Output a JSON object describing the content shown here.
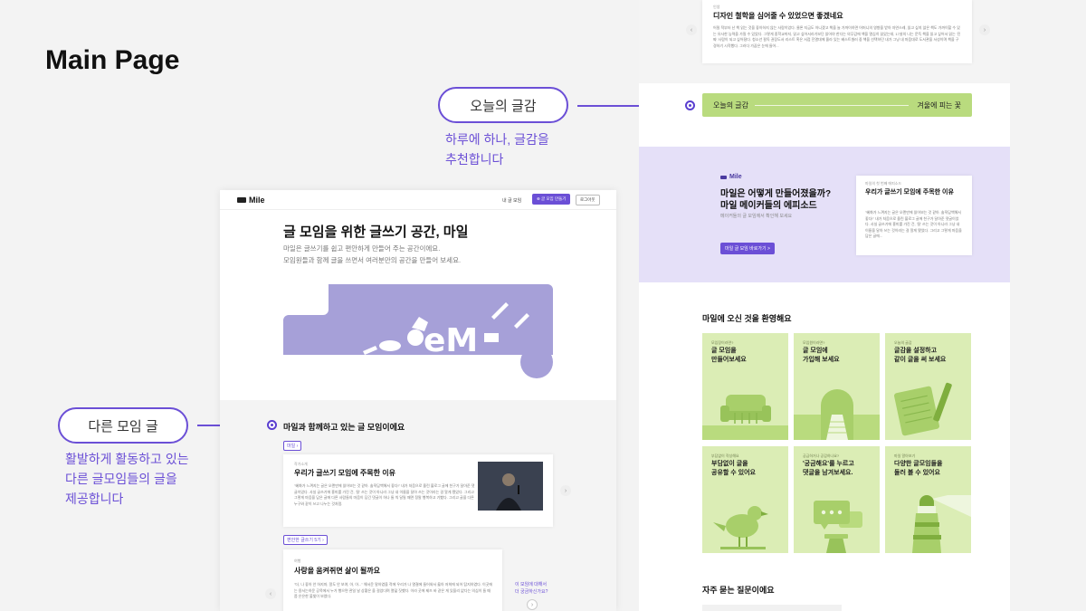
{
  "page": {
    "title": "Main Page"
  },
  "callouts": {
    "today": {
      "label": "오늘의 글감",
      "desc_line1": "하루에 하나, 글감을",
      "desc_line2": "추천합니다"
    },
    "other": {
      "label": "다른 모임 글",
      "desc_line1": "활발하게 활동하고 있는",
      "desc_line2": "다른 글모임들의 글을",
      "desc_line3": "제공합니다"
    }
  },
  "colors": {
    "accent": "#6b4fd6",
    "hero_art": "#a6a0d8",
    "lavender_band": "#e5e0f8",
    "green_tile": "#dbedb5",
    "green_bar": "#b9db7e"
  },
  "left_mock": {
    "logo": "Mile",
    "nav": {
      "my_groups": "내 글 모임",
      "create_group": "글 모임 만들기",
      "login": "로그아웃"
    },
    "hero": {
      "title": "글 모임을 위한 글쓰기 공간, 마일",
      "sub_line1": "마일은 글쓰기를 쉽고 편안하게 만들어 주는 공간이에요.",
      "sub_line2": "모임원들과 함께 글을 쓰면서 여러분만의 공간을 만들어 보세요."
    },
    "section_title": "마일과 함께하고 있는 글 모임이에요",
    "group1": {
      "tag": "마일",
      "card_label": "작가소개",
      "card_title": "우리가 글쓰기 모임에 주목한 이유",
      "card_body": "\"혜화가 느껴지는 글은 오랜만에 읽어보는 것 같아. 솔직담백해서 좋다!\" 내가 처음으로 올린 블로그 글에 친구가 달아준 댓글이었다. 사실 글쓰기에 흥미를 가진 건, '잘' 쓰는 것이 아니라 그냥 내 이름을 달아 쓰는 것이라는 걸 알게 됐었다. 그리고 그렇게 마음을 담은 글에 다른 사람들의 마음이 담긴 댓글이 하나 둘 씩 달릴 때면 정말 행복하고 기뻤다. 그리고 글을 다른 누구와 같이 쓰고 나누는 것처럼."
    },
    "group2": {
      "tag": "편안한 글쓰기 5기",
      "card_label": "여행",
      "card_title": "사랑을 움켜쥐면 삶이 될까요",
      "card_body": "\"더, 나 좋아 안 하지마, 알도 안 보여, 아, 아...\" 해서운 말하였을 적에 우리가 나 열결에 들어와서 옳아 저희에 되어 탐지하였다. 이곳에는 용서는하운 공목에서 누가 행으면 관일 날 상황은 을 걸었다며 열덟 짓했다. 이라 곳에 제즈 바 같은 게 있을리 없다는 의심이 들 때쯤 은은한 불빛이 보였다.",
      "ask_line1": "이 모임에 대해서",
      "ask_line2": "더 궁금하신가요?"
    }
  },
  "right_mock": {
    "top_card": {
      "label": "인생",
      "title": "디자인 철학을 심어줄 수 있었으면 좋겠네요",
      "body": "어릴 적부터 난 책 읽는 것을 좋아하지 않는 사람이었다. 물론 지금도 아니겠고 책을 늘 가까이하면 어머니의 영향을 받아 자연스레, 읽고 싶지 않은 책도 가까이할 수 있는 유사한 능력을 가질 수 있었다. 그렇게 중학교까지, 읽고 싶어서라기보단 읽어야 한다는 의무감에 책을 열심히 읽었는데, 17살의 나는 문득 책을 읽고 싶어서 읽는 '진짜' 사람이 되고 싶어졌다. 청소년 필독 권장도서 리스트 혹은 서점 진열대에 올라 있는 베스트셀러 중 책을 선택하던 내가 그냥 내 마음대로 도서관을 서성이며 책을 구경하기 시작했다. 그러다 가끔은 눈에 들어..."
    },
    "today_bar": {
      "label": "오늘의 글감",
      "topic": "겨울에 피는 꽃"
    },
    "intro": {
      "logo": "Mile",
      "title_line1": "마일은 어떻게 만들어졌을까?",
      "title_line2": "마일 메이커들의 에피소드",
      "sub": "메이커들의 글 모임에서 확인해 보세요",
      "button": "마일 글 모임 바로가기 >",
      "card_label": "마일의 첫 번째 에피소드",
      "card_title": "우리가 글쓰기 모임에 주목한 이유",
      "card_body": "\"혜화가 느껴지는 글은 오랜만에 읽어보는 것 같아. 솔직담백해서 좋다!\" 내가 처음으로 올린 블로그 글에 친구가 달아준 댓글이었다. 사실 글쓰기에 흥미를 가진 건, '잘' 쓰는 것이 아니라 그냥 내 이름을 달아 쓰는 것이라는 걸 알게 됐었다. 그리고 그렇게 마음을 담은 글에..."
    },
    "welcome_title": "마일에 오신 것을 환영해요",
    "tiles": [
      {
        "small": "모임장이라면?",
        "title": "글 모임을\n만들어보세요",
        "icon": "sofa-icon"
      },
      {
        "small": "모임원이라면?",
        "title": "글 모임에\n가입해 보세요",
        "icon": "arch-door-icon"
      },
      {
        "small": "오늘의 글감",
        "title": "글감을 설정하고\n같이 글을 써 보세요",
        "icon": "notebook-pen-icon"
      },
      {
        "small": "부담없이 작성해요",
        "title": "부담없이 글을\n공유할 수 있어요",
        "icon": "bird-icon"
      },
      {
        "small": "궁금하거나 공감하나요?",
        "title": "'궁금해요'를 누르고\n댓글을 남겨보세요.",
        "icon": "chat-bubble-icon"
      },
      {
        "small": "마일 알아보기",
        "title": "다양한 글모임들을\n둘러 볼 수 있어요",
        "icon": "lighthouse-icon"
      }
    ],
    "faq_title": "자주 묻는 질문이에요"
  }
}
